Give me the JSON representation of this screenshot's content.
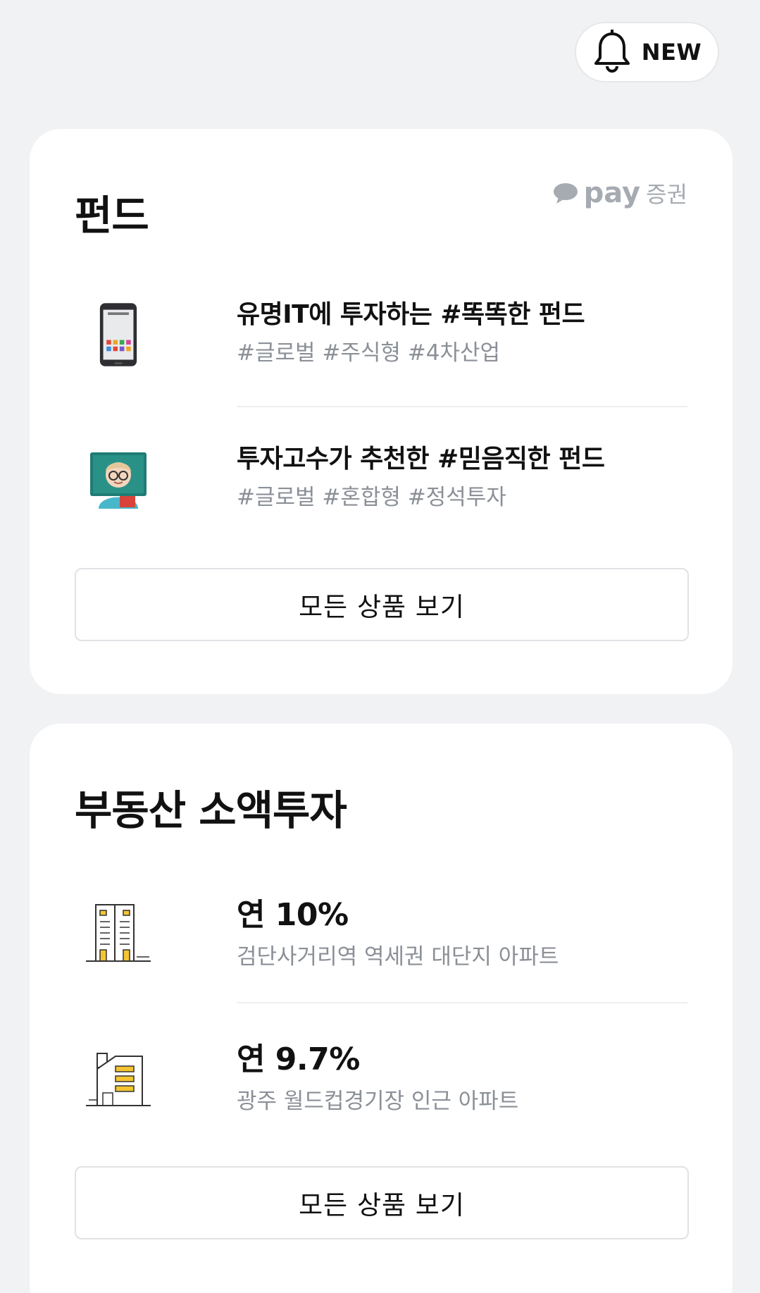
{
  "header": {
    "new_label": "NEW",
    "bell_icon": "bell-icon"
  },
  "fund": {
    "title": "펀드",
    "brand": {
      "pay": "pay",
      "sec": "증권"
    },
    "items": [
      {
        "title": "유명IT에 투자하는 #똑똑한 펀드",
        "tags": "#글로벌 #주식형 #4차산업",
        "icon": "smartphone-icon"
      },
      {
        "title": "투자고수가 추천한 #믿음직한 펀드",
        "tags": "#글로벌 #혼합형 #정석투자",
        "icon": "teacher-icon"
      }
    ],
    "all_button": "모든 상품 보기"
  },
  "estate": {
    "title": "부동산 소액투자",
    "items": [
      {
        "rate": "연 10%",
        "desc": "검단사거리역 역세권 대단지 아파트",
        "icon": "apartment-icon"
      },
      {
        "rate": "연 9.7%",
        "desc": "광주 월드컵경기장 인근 아파트",
        "icon": "house-icon"
      }
    ],
    "all_button": "모든 상품 보기"
  }
}
